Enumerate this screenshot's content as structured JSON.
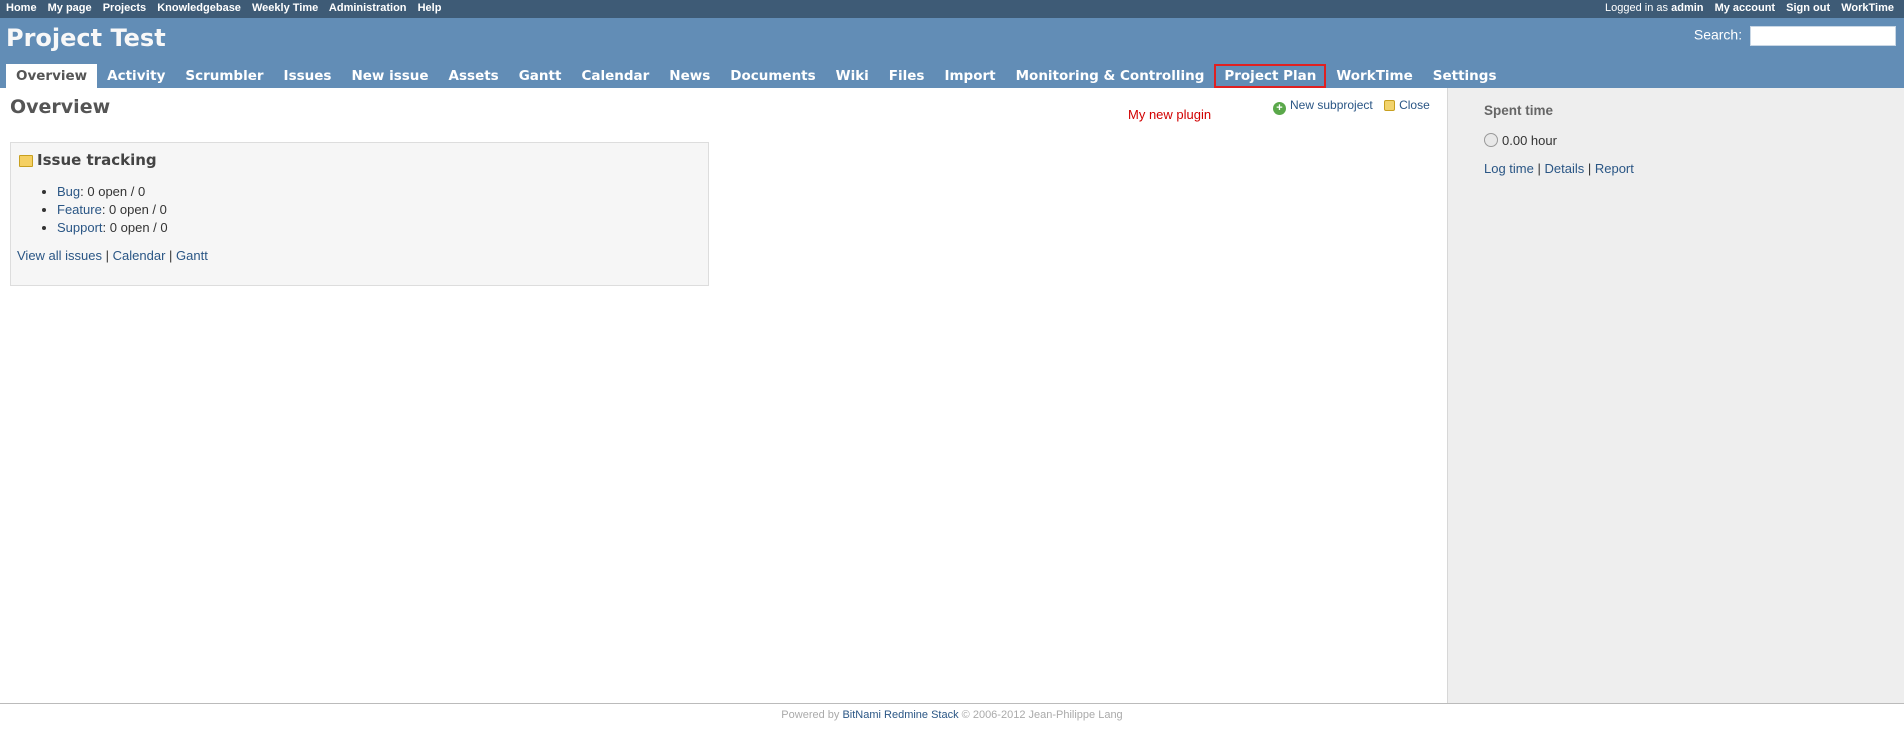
{
  "top_menu": {
    "left_items": [
      "Home",
      "My page",
      "Projects",
      "Knowledgebase",
      "Weekly Time",
      "Administration",
      "Help"
    ],
    "logged_in_label": "Logged in as",
    "logged_in_user": "admin",
    "right_items": [
      "My account",
      "Sign out",
      "WorkTime"
    ]
  },
  "header": {
    "title": "Project Test",
    "search_label": "Search:",
    "search_value": ""
  },
  "main_menu": {
    "tabs": [
      "Overview",
      "Activity",
      "Scrumbler",
      "Issues",
      "New issue",
      "Assets",
      "Gantt",
      "Calendar",
      "News",
      "Documents",
      "Wiki",
      "Files",
      "Import",
      "Monitoring & Controlling",
      "Project Plan",
      "WorkTime",
      "Settings"
    ],
    "selected": "Overview",
    "highlighted": "Project Plan"
  },
  "content": {
    "title": "Overview",
    "plugin_note": "My new plugin",
    "new_subproject": "New subproject",
    "close": "Close",
    "issue_tracking": {
      "title": "Issue tracking",
      "trackers": [
        {
          "name": "Bug",
          "status": "0 open / 0"
        },
        {
          "name": "Feature",
          "status": "0 open / 0"
        },
        {
          "name": "Support",
          "status": "0 open / 0"
        }
      ],
      "links": [
        "View all issues",
        "Calendar",
        "Gantt"
      ]
    }
  },
  "sidebar": {
    "title": "Spent time",
    "hours": "0.00 hour",
    "links": [
      "Log time",
      "Details",
      "Report"
    ]
  },
  "footer": {
    "prefix": "Powered by",
    "link": "BitNami Redmine Stack",
    "suffix": "© 2006-2012 Jean-Philippe Lang"
  },
  "colors": {
    "top_bar": "#3e5b76",
    "header": "#628db6",
    "highlight": "#e02020",
    "link": "#2a5685"
  }
}
